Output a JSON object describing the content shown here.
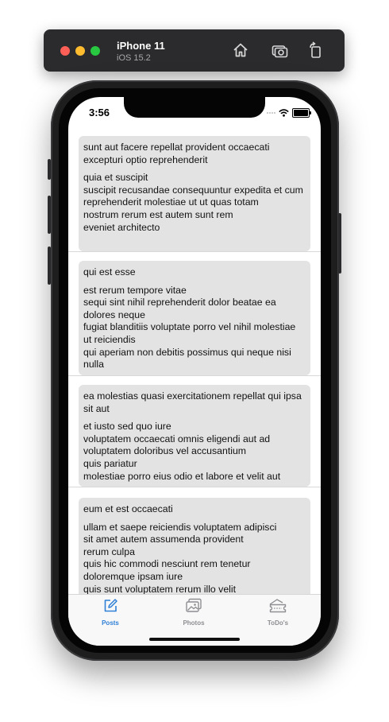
{
  "simulator": {
    "device_name": "iPhone 11",
    "os_version": "iOS 15.2",
    "tools": [
      "home-icon",
      "screenshot-icon",
      "rotate-icon"
    ]
  },
  "status_bar": {
    "time": "3:56"
  },
  "posts": [
    {
      "title": "sunt aut facere repellat provident occaecati excepturi optio reprehenderit",
      "body": "quia et suscipit\nsuscipit recusandae consequuntur expedita et cum\nreprehenderit molestiae ut ut quas totam\nnostrum rerum est autem sunt rem\neveniet architecto"
    },
    {
      "title": "qui est esse",
      "body": "est rerum tempore vitae\nsequi sint nihil reprehenderit dolor beatae ea dolores neque\nfugiat blanditiis voluptate porro vel nihil molestiae ut reiciendis\nqui aperiam non debitis possimus qui neque nisi nulla"
    },
    {
      "title": "ea molestias quasi exercitationem repellat qui ipsa sit aut",
      "body": "et iusto sed quo iure\nvoluptatem occaecati omnis eligendi aut ad\nvoluptatem doloribus vel accusantium\nquis pariatur\nmolestiae porro eius odio et labore et velit aut"
    },
    {
      "title": "eum et est occaecati",
      "body": "ullam et saepe reiciendis voluptatem adipisci\nsit amet autem assumenda provident\nrerum culpa\nquis hic commodi nesciunt rem tenetur\ndoloremque ipsam iure\nquis sunt voluptatem rerum illo velit"
    }
  ],
  "tabs": [
    {
      "label": "Posts",
      "icon": "compose-icon",
      "active": true
    },
    {
      "label": "Photos",
      "icon": "photos-icon",
      "active": false
    },
    {
      "label": "ToDo's",
      "icon": "ticket-icon",
      "active": false
    }
  ],
  "colors": {
    "accent": "#2f80d6",
    "inactive_tab": "#8e8e93",
    "card_bg": "#e3e3e3"
  }
}
